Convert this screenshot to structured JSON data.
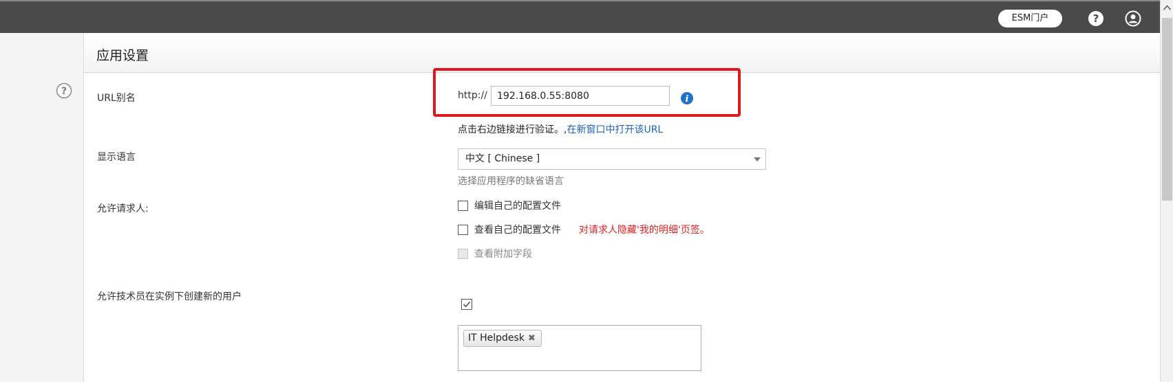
{
  "topbar": {
    "esm_portal_label": "ESM门户"
  },
  "page": {
    "title": "应用设置"
  },
  "url_alias": {
    "label": "URL别名",
    "prefix": "http://",
    "value": "192.168.0.55:8080",
    "verify_text": "点击右边链接进行验证。,",
    "verify_link": "在新窗口中打开该URL"
  },
  "language": {
    "label": "显示语言",
    "selected": "中文 [ Chinese ]",
    "help": "选择应用程序的缺省语言"
  },
  "requester": {
    "label": "允许请求人:",
    "options": [
      {
        "label": "编辑自己的配置文件",
        "checked": false,
        "disabled": false
      },
      {
        "label": "查看自己的配置文件",
        "checked": false,
        "disabled": false
      },
      {
        "label": "查看附加字段",
        "checked": false,
        "disabled": true
      }
    ],
    "note": "对请求人隐藏'我的明细'页签。"
  },
  "technician": {
    "label": "允许技术员在实例下创建新的用户",
    "checked": true,
    "tags": [
      "IT Helpdesk"
    ]
  },
  "colors": {
    "topbar": "#4a4a4a",
    "highlight": "#e0171b",
    "link": "#1a62b8",
    "note": "#e02020"
  }
}
